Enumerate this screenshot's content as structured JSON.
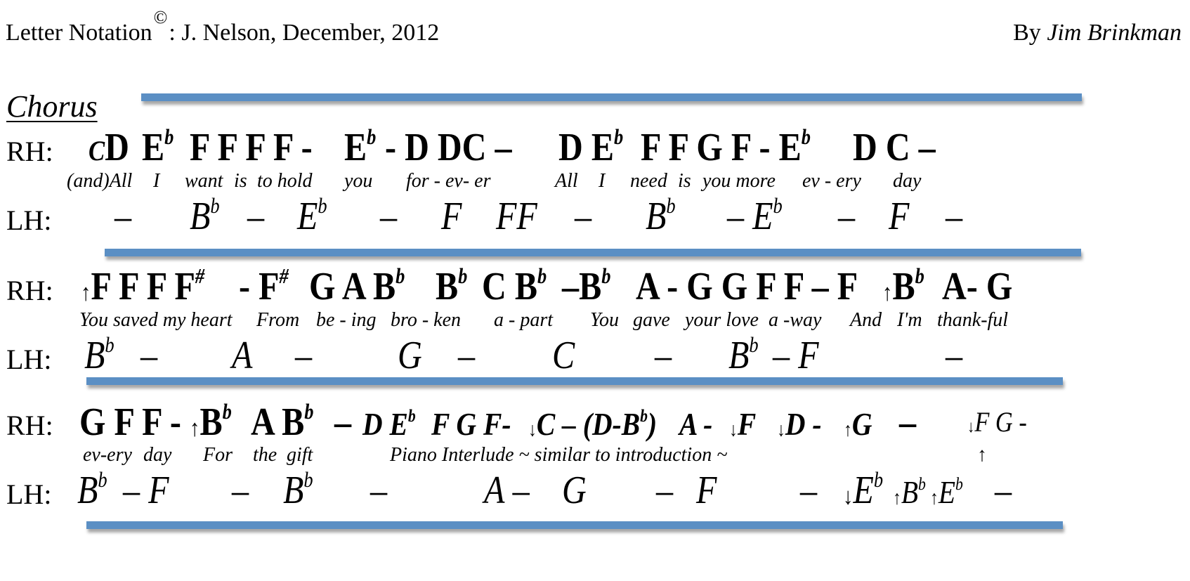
{
  "header": {
    "title": "Letter Notation",
    "copyright_symbol": "©",
    "title_suffix": ": J. Nelson, December, 2012",
    "by_label": "By",
    "author": "Jim Brinkman"
  },
  "section": {
    "title": "Chorus"
  },
  "labels": {
    "rh": "RH:",
    "lh": "LH:"
  },
  "colors": {
    "bar": "#5b8fc4"
  },
  "systems": [
    {
      "rh_tokens": [
        {
          "pre": "",
          "small": "C",
          "note": "D",
          "acc": ""
        },
        {
          "note": "E",
          "acc": "b"
        },
        {
          "note": "F F F F -",
          "acc": ""
        },
        {
          "note": "E",
          "acc": "b"
        },
        {
          "note": "- D DC –",
          "acc": ""
        },
        {
          "note": "D E",
          "acc": "b"
        },
        {
          "note": "F F G F - E",
          "acc": "b"
        },
        {
          "note": "D C –",
          "acc": ""
        }
      ],
      "lyrics": [
        "(and)All",
        "I",
        "want",
        "is",
        "to hold",
        "you",
        "for - ev- er",
        "All",
        "I",
        "need",
        "is",
        "you more",
        "ev - ery",
        "day"
      ],
      "lh_tokens": [
        {
          "note": "–",
          "acc": ""
        },
        {
          "note": "B",
          "acc": "b"
        },
        {
          "note": "–",
          "acc": ""
        },
        {
          "note": "E",
          "acc": "b"
        },
        {
          "note": "–",
          "acc": ""
        },
        {
          "note": "F",
          "acc": ""
        },
        {
          "note": "FF",
          "acc": ""
        },
        {
          "note": "–",
          "acc": ""
        },
        {
          "note": "B",
          "acc": "b"
        },
        {
          "note": "– E",
          "acc": "b"
        },
        {
          "note": "–",
          "acc": ""
        },
        {
          "note": "F",
          "acc": ""
        },
        {
          "note": "–",
          "acc": ""
        }
      ]
    },
    {
      "rh_tokens": [
        {
          "arrow": "↑",
          "note": "F F F F",
          "acc": "#"
        },
        {
          "note": "- F",
          "acc": "#"
        },
        {
          "note": "G A B",
          "acc": "b"
        },
        {
          "note": "B",
          "acc": "b"
        },
        {
          "note": "C B",
          "acc": "b"
        },
        {
          "note": "–B",
          "acc": "b"
        },
        {
          "note": "A - G G F F – F",
          "acc": ""
        },
        {
          "arrow": "↑",
          "note": "B",
          "acc": "b"
        },
        {
          "note": "A- G",
          "acc": ""
        }
      ],
      "lyrics": [
        "You saved my heart",
        "From",
        "be - ing",
        "bro - ken",
        "a - part",
        "You",
        "gave",
        "your love",
        "a -way",
        "And",
        "I'm",
        "thank-ful"
      ],
      "lh_tokens": [
        {
          "note": "B",
          "acc": "b"
        },
        {
          "note": "–",
          "acc": ""
        },
        {
          "note": "A",
          "acc": ""
        },
        {
          "note": "–",
          "acc": ""
        },
        {
          "note": "G",
          "acc": ""
        },
        {
          "note": "–",
          "acc": ""
        },
        {
          "note": "C",
          "acc": ""
        },
        {
          "note": "–",
          "acc": ""
        },
        {
          "note": "B",
          "acc": "b"
        },
        {
          "note": "– F",
          "acc": ""
        },
        {
          "note": "–",
          "acc": ""
        }
      ]
    },
    {
      "rh_tokens": [
        {
          "note": "G F F -",
          "acc": ""
        },
        {
          "arrow": "↑",
          "note": "B",
          "acc": "b"
        },
        {
          "note": "A B",
          "acc": "b"
        },
        {
          "note": "–",
          "acc": ""
        },
        {
          "note": "D E",
          "acc": "b",
          "style": "italic"
        },
        {
          "note": "F G F-",
          "acc": "",
          "style": "italic"
        },
        {
          "arrow": "↓",
          "note": "C – (D-B",
          "acc": "b",
          "tail": ")",
          "style": "italic"
        },
        {
          "note": "A -",
          "acc": "",
          "style": "italic"
        },
        {
          "arrow": "↓",
          "note": "F",
          "acc": "",
          "style": "italic"
        },
        {
          "arrow": "↓",
          "note": "D -",
          "acc": "",
          "style": "italic"
        },
        {
          "arrow": "↑",
          "note": "G",
          "acc": "",
          "style": "italic"
        },
        {
          "note": "–",
          "acc": ""
        },
        {
          "arrow": "↓",
          "note": "F G -",
          "acc": "",
          "style": "italic-light"
        }
      ],
      "lyrics": [
        "ev-ery",
        "day",
        "For",
        "the",
        "gift",
        "Piano Interlude ~ similar to introduction ~",
        "↑"
      ],
      "lh_tokens": [
        {
          "note": "B",
          "acc": "b"
        },
        {
          "note": "– F",
          "acc": ""
        },
        {
          "note": "–",
          "acc": ""
        },
        {
          "note": "B",
          "acc": "b"
        },
        {
          "note": "–",
          "acc": ""
        },
        {
          "note": "A –",
          "acc": ""
        },
        {
          "note": "G",
          "acc": ""
        },
        {
          "note": "–",
          "acc": ""
        },
        {
          "note": "F",
          "acc": ""
        },
        {
          "note": "–",
          "acc": ""
        },
        {
          "arrow": "↓",
          "note": "E",
          "acc": "b"
        },
        {
          "arrow": "↑",
          "note": "B",
          "acc": "b",
          "small": true
        },
        {
          "arrow": "↑",
          "note": "E",
          "acc": "b",
          "small": true
        },
        {
          "note": "–",
          "acc": ""
        }
      ]
    }
  ]
}
